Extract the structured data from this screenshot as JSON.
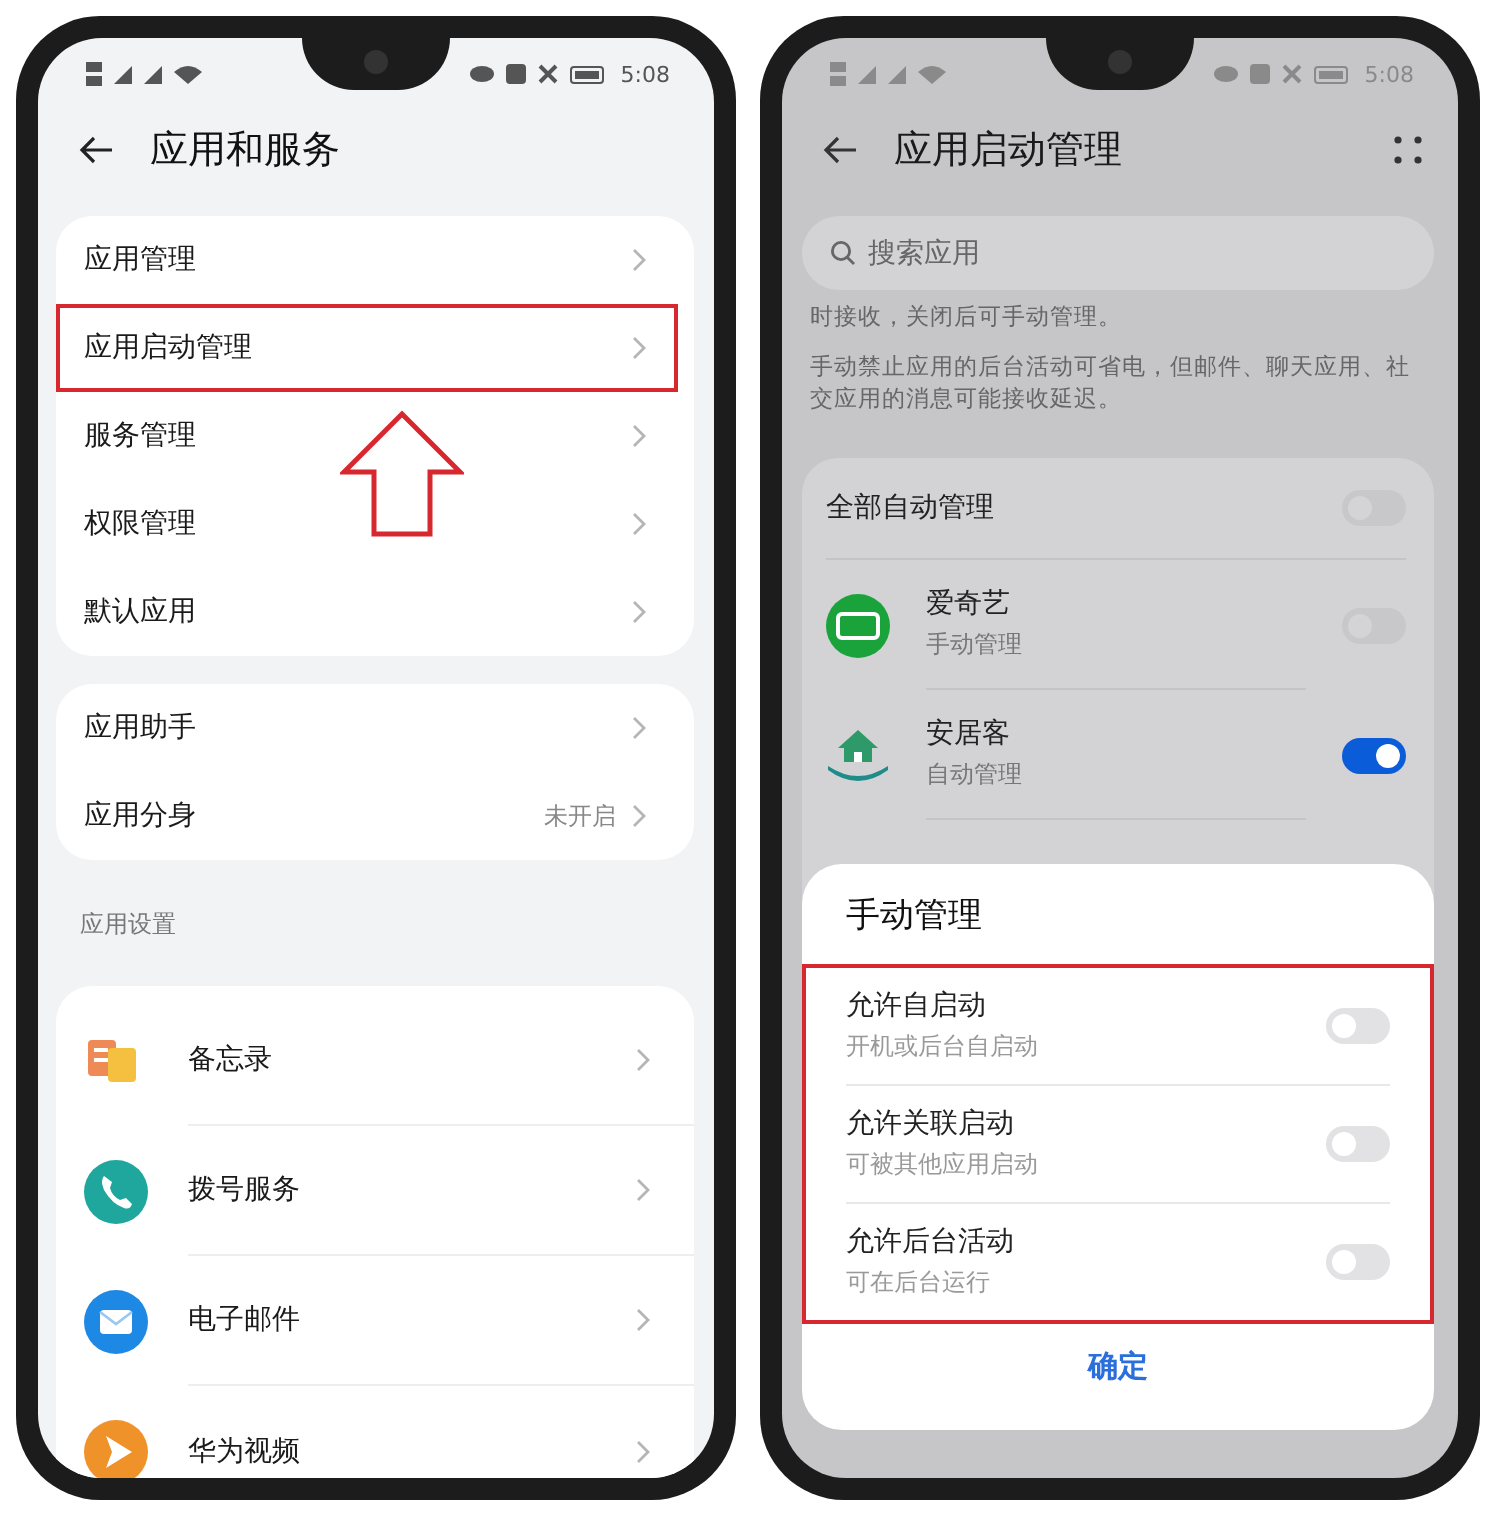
{
  "left_phone": {
    "status_bar": {
      "time": "5:08"
    },
    "header": {
      "title": "应用和服务"
    },
    "groups": [
      {
        "items": [
          {
            "label": "应用管理",
            "highlighted": false
          },
          {
            "label": "应用启动管理",
            "highlighted": true
          },
          {
            "label": "服务管理",
            "highlighted": false
          },
          {
            "label": "权限管理",
            "highlighted": false
          },
          {
            "label": "默认应用",
            "highlighted": false
          }
        ]
      },
      {
        "items": [
          {
            "label": "应用助手",
            "highlighted": false
          },
          {
            "label": "应用分身",
            "value": "未开启",
            "highlighted": false
          }
        ]
      }
    ],
    "section_label": "应用设置",
    "apps": [
      {
        "label": "备忘录"
      },
      {
        "label": "拨号服务"
      },
      {
        "label": "电子邮件"
      },
      {
        "label": "华为视频"
      }
    ]
  },
  "right_phone": {
    "status_bar": {
      "time": "5:08"
    },
    "header": {
      "title": "应用启动管理"
    },
    "search": {
      "placeholder": "搜索应用"
    },
    "notes": [
      "时接收，关闭后可手动管理。",
      "手动禁止应用的后台活动可省电，但邮件、聊天应用、社交应用的消息可能接收延迟。"
    ],
    "master": {
      "label": "全部自动管理",
      "on": false
    },
    "apps": [
      {
        "name": "爱奇艺",
        "mode": "手动管理",
        "on": false
      },
      {
        "name": "安居客",
        "mode": "自动管理",
        "on": true
      }
    ],
    "dialog": {
      "title": "手动管理",
      "options_highlighted": true,
      "options": [
        {
          "label": "允许自启动",
          "description": "开机或后台自启动",
          "on": false
        },
        {
          "label": "允许关联启动",
          "description": "可被其他应用启动",
          "on": false
        },
        {
          "label": "允许后台活动",
          "description": "可在后台运行",
          "on": false
        }
      ],
      "confirm": "确定"
    }
  }
}
